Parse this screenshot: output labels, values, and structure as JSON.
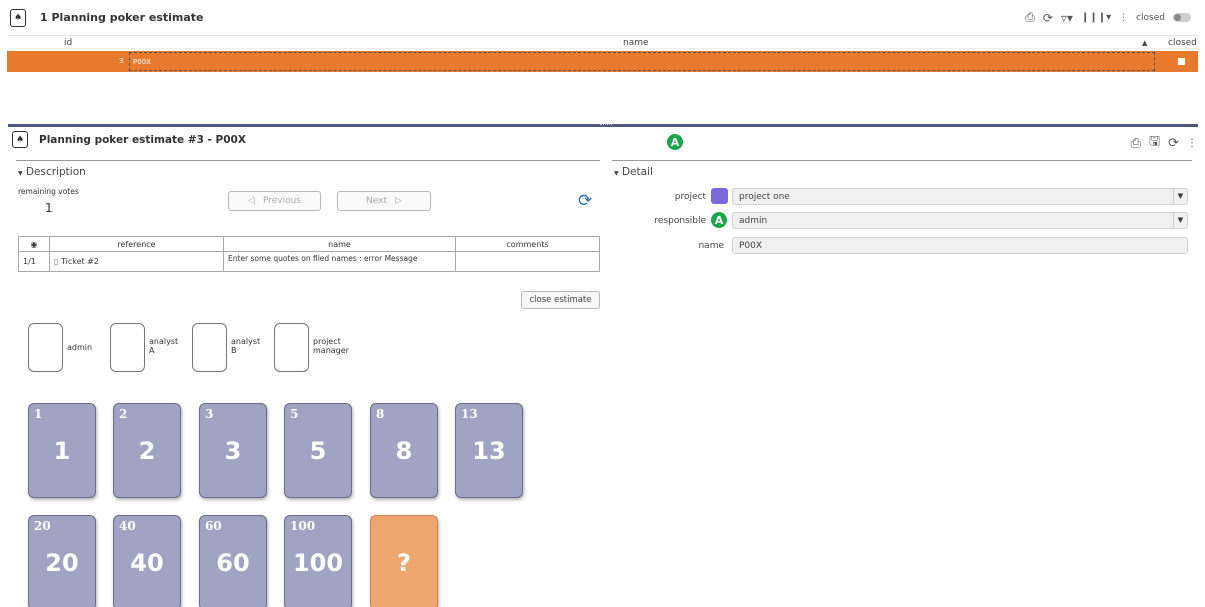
{
  "list": {
    "title": "1 Planning poker estimate",
    "closed_label": "closed",
    "columns": [
      "id",
      "name",
      "closed"
    ],
    "rows": [
      {
        "id": "3",
        "name": "P00X"
      }
    ]
  },
  "detail": {
    "title": "Planning poker estimate  #3  - P00X",
    "header_avatar": "A",
    "description": {
      "section_title": "Description",
      "remaining_votes_label": "remaining votes",
      "remaining_votes_value": "1",
      "previous_label": "Previous",
      "next_label": "Next",
      "table": {
        "headers": [
          "reference",
          "name",
          "comments"
        ],
        "row": {
          "count": "1/1",
          "reference": "Ticket #2",
          "name": "Enter some quotes on filed names : error Message",
          "comments": ""
        }
      },
      "close_label": "close estimate",
      "voters": [
        {
          "name_line1": "admin",
          "name_line2": ""
        },
        {
          "name_line1": "analyst",
          "name_line2": "A"
        },
        {
          "name_line1": "analyst",
          "name_line2": "B"
        },
        {
          "name_line1": "project",
          "name_line2": "manager"
        }
      ],
      "cards": [
        "1",
        "2",
        "3",
        "5",
        "8",
        "13",
        "20",
        "40",
        "60",
        "100",
        "?"
      ]
    },
    "fields": {
      "section_title": "Detail",
      "project_label": "project",
      "project_value": "project one",
      "project_color": "#7b68d9",
      "responsible_label": "responsible",
      "responsible_avatar": "A",
      "responsible_value": "admin",
      "name_label": "name",
      "name_value": "P00X"
    }
  },
  "colors": {
    "selection": "#e87a2e",
    "card": "#a0a3c2",
    "card_unknown": "#f0a66f",
    "avatar": "#1aa64a"
  }
}
